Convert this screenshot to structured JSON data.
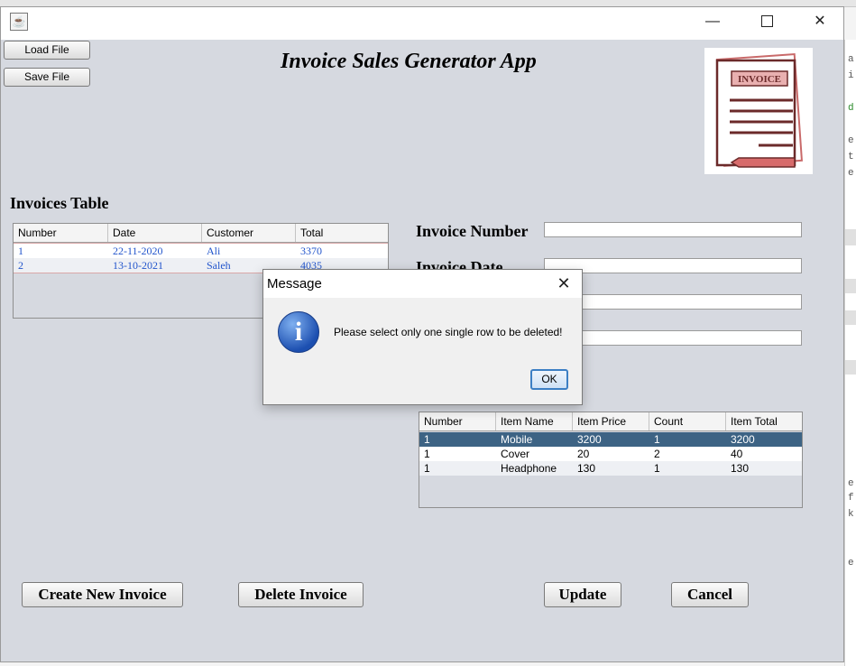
{
  "window": {
    "minimize_glyph": "—",
    "close_glyph": "✕"
  },
  "toolbar": {
    "load_label": "Load File",
    "save_label": "Save File"
  },
  "app_title": "Invoice Sales Generator App",
  "logo": {
    "text": "INVOICE"
  },
  "invoices": {
    "heading": "Invoices Table",
    "columns": [
      "Number",
      "Date",
      "Customer",
      "Total"
    ],
    "rows": [
      [
        "1",
        "22-11-2020",
        "Ali",
        "3370"
      ],
      [
        "2",
        "13-10-2021",
        "Saleh",
        "4035"
      ]
    ]
  },
  "form": {
    "invoice_number_label": "Invoice Number",
    "invoice_date_label": "Invoice Date",
    "invoice_number_value": "",
    "invoice_date_value": ""
  },
  "items": {
    "columns": [
      "Number",
      "Item Name",
      "Item Price",
      "Count",
      "Item Total"
    ],
    "rows": [
      [
        "1",
        "Mobile",
        "3200",
        "1",
        "3200"
      ],
      [
        "1",
        "Cover",
        "20",
        "2",
        "40"
      ],
      [
        "1",
        "Headphone",
        "130",
        "1",
        "130"
      ]
    ],
    "selected_row": 0,
    "selected_color": "#3d6384"
  },
  "buttons": {
    "create": "Create New Invoice",
    "delete": "Delete Invoice",
    "update": "Update",
    "cancel": "Cancel"
  },
  "dialog": {
    "title": "Message",
    "close_glyph": "✕",
    "icon_glyph": "i",
    "message": "Please select only one single row to be deleted!",
    "ok_label": "OK"
  },
  "background_code": {
    "snippets": [
      "a",
      "i",
      "d",
      "e",
      "t",
      "e",
      "e",
      "f",
      "k",
      "e"
    ]
  }
}
